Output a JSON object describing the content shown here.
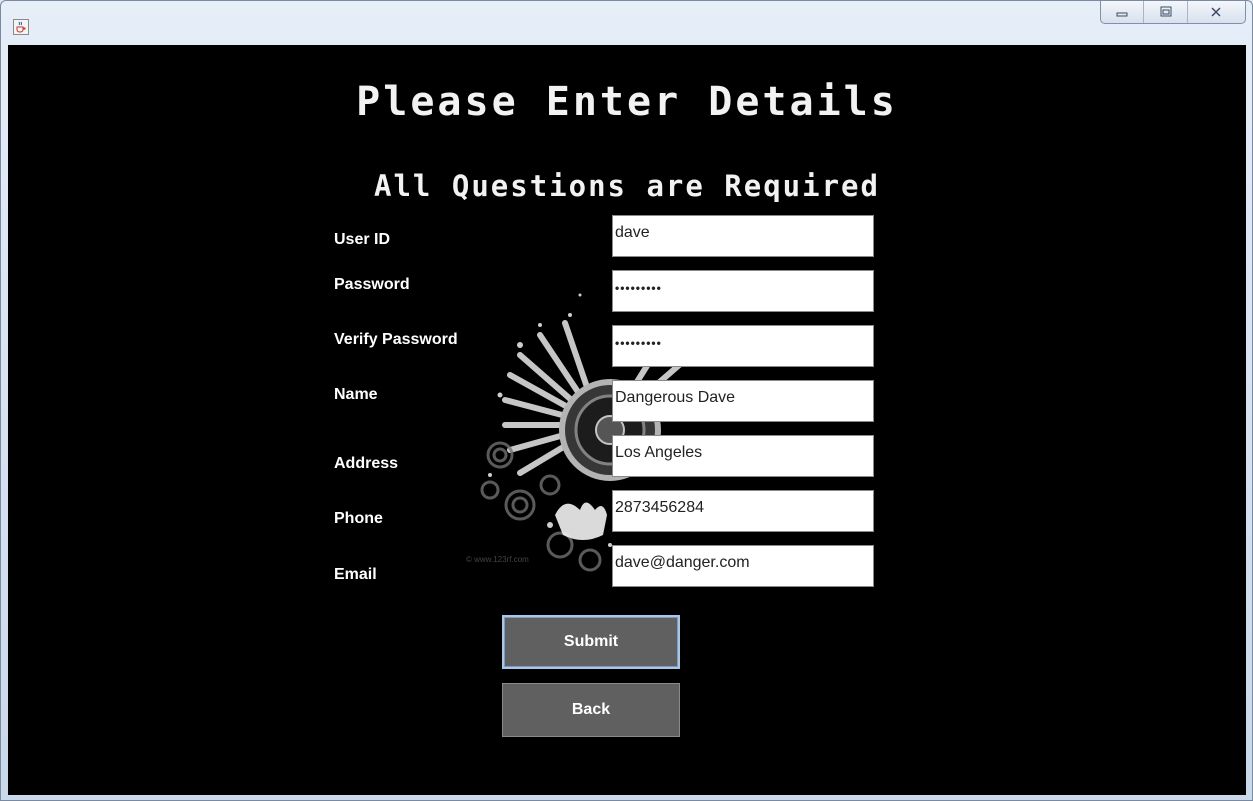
{
  "window": {
    "icon": "java-cup-icon",
    "controls": [
      "minimize-icon",
      "maximize-icon",
      "close-icon"
    ]
  },
  "header": {
    "title": "Please Enter Details",
    "subtitle": "All Questions are Required"
  },
  "form": {
    "fields": [
      {
        "label": "User ID",
        "value": "dave",
        "type": "text"
      },
      {
        "label": "Password",
        "value": "•••••••••",
        "type": "password"
      },
      {
        "label": "Verify Password",
        "value": "•••••••••",
        "type": "password"
      },
      {
        "label": "Name",
        "value": "Dangerous Dave",
        "type": "text"
      },
      {
        "label": "Address",
        "value": "Los Angeles",
        "type": "text"
      },
      {
        "label": "Phone",
        "value": "2873456284",
        "type": "text"
      },
      {
        "label": "Email",
        "value": "dave@danger.com",
        "type": "text"
      }
    ]
  },
  "buttons": {
    "submit": "Submit",
    "back": "Back"
  },
  "background": {
    "image": "speaker-wings-splash-icon",
    "watermark": "© www.123rf.com"
  },
  "colors": {
    "background": "#000000",
    "button": "#606060",
    "text": "#ffffff",
    "focus": "#a9c6e6"
  }
}
